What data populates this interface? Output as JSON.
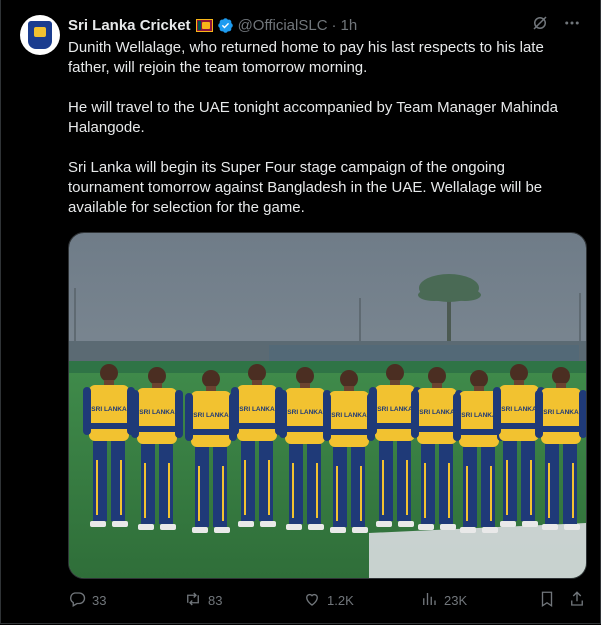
{
  "tweet": {
    "display_name": "Sri Lanka Cricket",
    "handle": "@OfficialSLC",
    "separator": "·",
    "time": "1h",
    "paragraphs": [
      "Dunith Wellalage, who returned home to pay his last respects to his late father, will rejoin the team tomorrow morning.",
      "He will travel to the UAE tonight accompanied by Team Manager Mahinda Halangode.",
      "Sri Lanka will begin its Super Four stage campaign of the ongoing tournament tomorrow against Bangladesh in the UAE. Wellalage will be available for selection for the game."
    ],
    "shirt_text": "SRI LANKA"
  },
  "icons": {
    "verified": "verified-badge-icon",
    "grok": "grok-icon",
    "more": "more-icon",
    "reply": "reply-icon",
    "retweet": "retweet-icon",
    "like": "like-icon",
    "views": "views-icon",
    "bookmark": "bookmark-icon",
    "share": "share-icon"
  },
  "actions": {
    "replies": "33",
    "retweets": "83",
    "likes": "1.2K",
    "views": "23K"
  },
  "colors": {
    "background": "#000000",
    "text": "#e7e9ea",
    "muted": "#71767b",
    "verified": "#1d9bf0",
    "jersey_navy": "#1f3a78",
    "jersey_yellow": "#f2c230"
  }
}
